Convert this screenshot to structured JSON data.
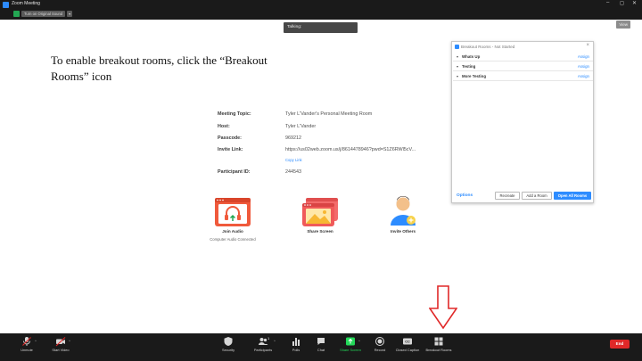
{
  "window": {
    "title": "Zoom Meeting",
    "original_sound_label": "Turn on Original Sound",
    "view_label": "View",
    "talking_label": "Talking:"
  },
  "instruction": {
    "line1": "To enable breakout rooms, click the “Breakout",
    "line2": "Rooms” icon"
  },
  "meeting_info": {
    "rows": [
      {
        "label": "Meeting Topic:",
        "value": "Tyler L'Vander's Personal Meeting Room"
      },
      {
        "label": "Host:",
        "value": "Tyler L'Vander"
      },
      {
        "label": "Passcode:",
        "value": "969212"
      },
      {
        "label": "Invite Link:",
        "value": "https://us02web.zoom.us/j/8614478946?pwd=S1Z6RWl5cV..."
      },
      {
        "label": "Participant ID:",
        "value": "244543"
      }
    ],
    "copy_link": "Copy Link"
  },
  "actions": {
    "join_audio": "Join Audio",
    "join_audio_sub": "Computer Audio Connected",
    "share_screen": "Share Screen",
    "invite_others": "Invite Others"
  },
  "breakout_panel": {
    "title": "Breakout Rooms - Not Started",
    "rooms": [
      {
        "name": "Whats Up",
        "assign": "Assign"
      },
      {
        "name": "Testing",
        "assign": "Assign"
      },
      {
        "name": "More Testing",
        "assign": "Assign"
      }
    ],
    "options": "Options",
    "recreate": "Recreate",
    "add_room": "Add a Room",
    "open_all": "Open All Rooms"
  },
  "toolbar": {
    "unmute": "Unmute",
    "start_video": "Start Video",
    "security": "Security",
    "participants": "Participants",
    "participants_count": "1",
    "polls": "Polls",
    "chat": "Chat",
    "share_screen": "Share Screen",
    "record": "Record",
    "closed_caption": "Closed Caption",
    "breakout_rooms": "Breakout Rooms",
    "end": "End"
  },
  "colors": {
    "accent": "#2d8cff",
    "share_green": "#23d959",
    "end_red": "#e02828",
    "arrow_red": "#e02828",
    "toolbar_bg": "#1a1a1a"
  }
}
